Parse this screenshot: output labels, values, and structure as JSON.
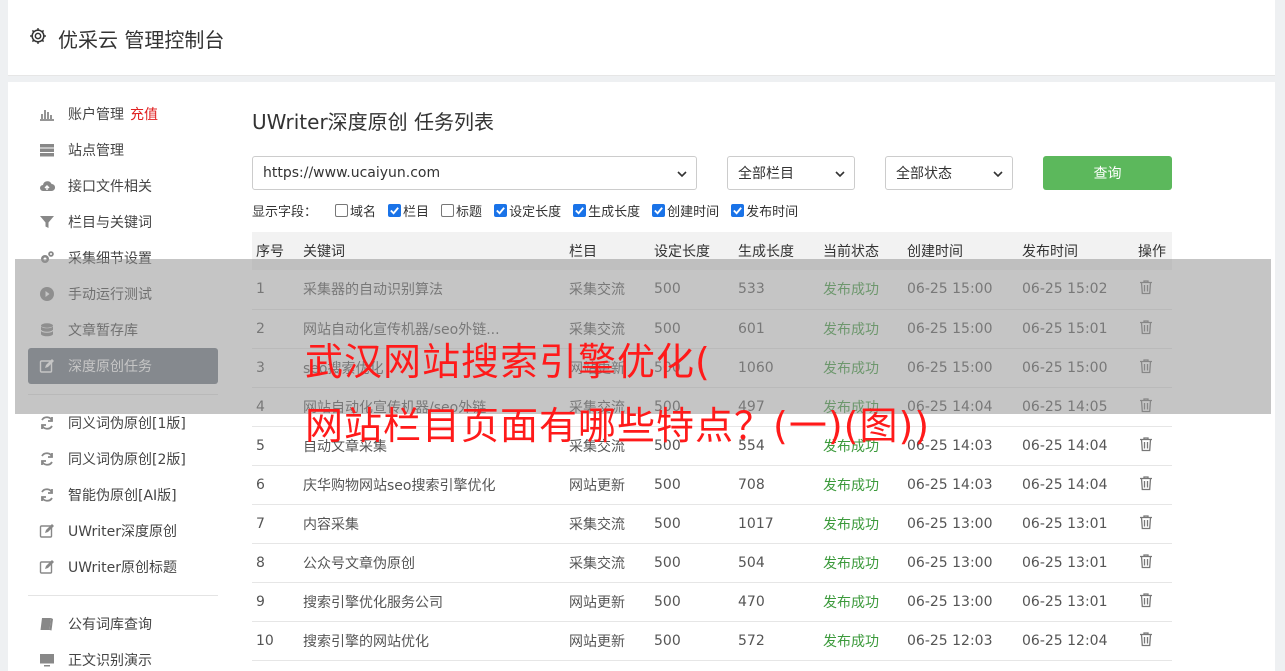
{
  "header": {
    "title": "优采云 管理控制台",
    "icon": "gear-icon"
  },
  "sidebar": {
    "group1": [
      {
        "label": "账户管理",
        "extra": "充值",
        "icon": "bar-chart-icon"
      },
      {
        "label": "站点管理",
        "icon": "server-icon"
      },
      {
        "label": "接口文件相关",
        "icon": "cloud-upload-icon"
      },
      {
        "label": "栏目与关键词",
        "icon": "filter-icon"
      },
      {
        "label": "采集细节设置",
        "icon": "gears-icon"
      },
      {
        "label": "手动运行测试",
        "icon": "play-icon"
      },
      {
        "label": "文章暂存库",
        "icon": "database-icon"
      },
      {
        "label": "深度原创任务",
        "icon": "edit-icon",
        "active": true
      }
    ],
    "group2": [
      {
        "label": "同义词伪原创[1版]",
        "icon": "refresh-icon"
      },
      {
        "label": "同义词伪原创[2版]",
        "icon": "refresh-icon"
      },
      {
        "label": "智能伪原创[AI版]",
        "icon": "refresh-icon"
      },
      {
        "label": "UWriter深度原创",
        "icon": "edit-icon"
      },
      {
        "label": "UWriter原创标题",
        "icon": "edit-icon"
      }
    ],
    "group3": [
      {
        "label": "公有词库查询",
        "icon": "book-icon"
      },
      {
        "label": "正文识别演示",
        "icon": "monitor-icon"
      }
    ]
  },
  "main": {
    "title": "UWriter深度原创 任务列表",
    "filters": {
      "site": "https://www.ucaiyun.com",
      "column": "全部栏目",
      "status": "全部状态",
      "query_label": "查询"
    },
    "fields_label": "显示字段：",
    "fields": [
      {
        "label": "域名",
        "checked": false
      },
      {
        "label": "栏目",
        "checked": true
      },
      {
        "label": "标题",
        "checked": false
      },
      {
        "label": "设定长度",
        "checked": true
      },
      {
        "label": "生成长度",
        "checked": true
      },
      {
        "label": "创建时间",
        "checked": true
      },
      {
        "label": "发布时间",
        "checked": true
      }
    ],
    "table": {
      "headers": [
        "序号",
        "关键词",
        "栏目",
        "设定长度",
        "生成长度",
        "当前状态",
        "创建时间",
        "发布时间",
        "操作"
      ],
      "rows": [
        [
          "1",
          "采集器的自动识别算法",
          "采集交流",
          "500",
          "533",
          "发布成功",
          "06-25 15:00",
          "06-25 15:02"
        ],
        [
          "2",
          "网站自动化宣传机器/seo外链...",
          "采集交流",
          "500",
          "601",
          "发布成功",
          "06-25 15:00",
          "06-25 15:01"
        ],
        [
          "3",
          "seo搜索优化",
          "网站更新",
          "500",
          "1060",
          "发布成功",
          "06-25 15:00",
          "06-25 15:00"
        ],
        [
          "4",
          "网站自动化宣传机器/seo外链",
          "采集交流",
          "500",
          "497",
          "发布成功",
          "06-25 14:04",
          "06-25 14:05"
        ],
        [
          "5",
          "自动文章采集",
          "采集交流",
          "500",
          "554",
          "发布成功",
          "06-25 14:03",
          "06-25 14:04"
        ],
        [
          "6",
          "庆华购物网站seo搜索引擎优化",
          "网站更新",
          "500",
          "708",
          "发布成功",
          "06-25 14:03",
          "06-25 14:04"
        ],
        [
          "7",
          "内容采集",
          "采集交流",
          "500",
          "1017",
          "发布成功",
          "06-25 13:00",
          "06-25 13:01"
        ],
        [
          "8",
          "公众号文章伪原创",
          "采集交流",
          "500",
          "504",
          "发布成功",
          "06-25 13:00",
          "06-25 13:01"
        ],
        [
          "9",
          "搜索引擎优化服务公司",
          "网站更新",
          "500",
          "470",
          "发布成功",
          "06-25 13:00",
          "06-25 13:01"
        ],
        [
          "10",
          "搜索引擎的网站优化",
          "网站更新",
          "500",
          "572",
          "发布成功",
          "06-25 12:03",
          "06-25 12:04"
        ]
      ]
    }
  },
  "overlay": {
    "line1": "武汉网站搜索引擎优化(",
    "line2": "网站栏目页面有哪些特点？(一)(图))"
  }
}
